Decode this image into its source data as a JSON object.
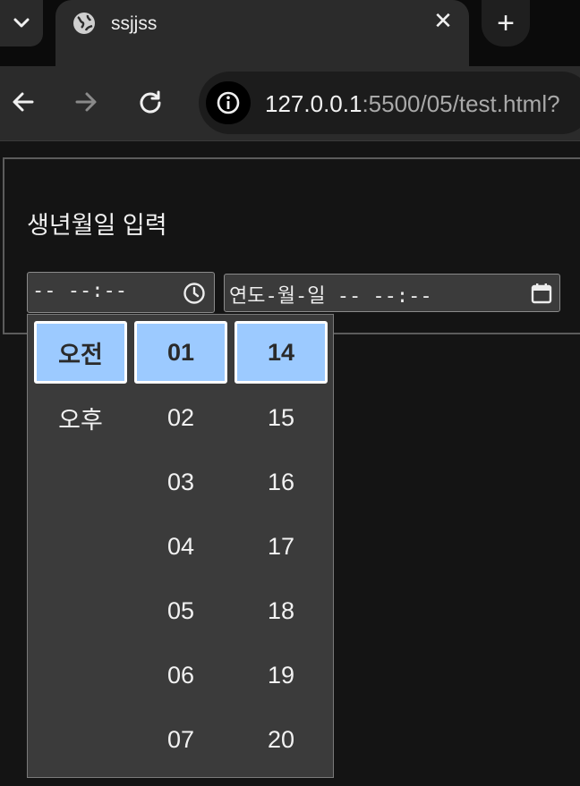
{
  "browser": {
    "tab": {
      "title": "ssjjss"
    },
    "new_tab_label": "+",
    "close_label": "✕",
    "url": {
      "host": "127.0.0.1",
      "rest": ":5500/05/test.html?"
    }
  },
  "page": {
    "heading": "생년월일 입력",
    "time_input": {
      "value": "-- --:--"
    },
    "datetime_input": {
      "value": "연도-월-일 -- --:--"
    }
  },
  "time_picker": {
    "meridiem": [
      "오전",
      "오후"
    ],
    "hours": [
      "01",
      "02",
      "03",
      "04",
      "05",
      "06",
      "07"
    ],
    "minutes": [
      "14",
      "15",
      "16",
      "17",
      "18",
      "19",
      "20"
    ],
    "selected": {
      "meridiem": "오전",
      "hour": "01",
      "minute": "14"
    },
    "selected_color": "#9ccaff"
  }
}
